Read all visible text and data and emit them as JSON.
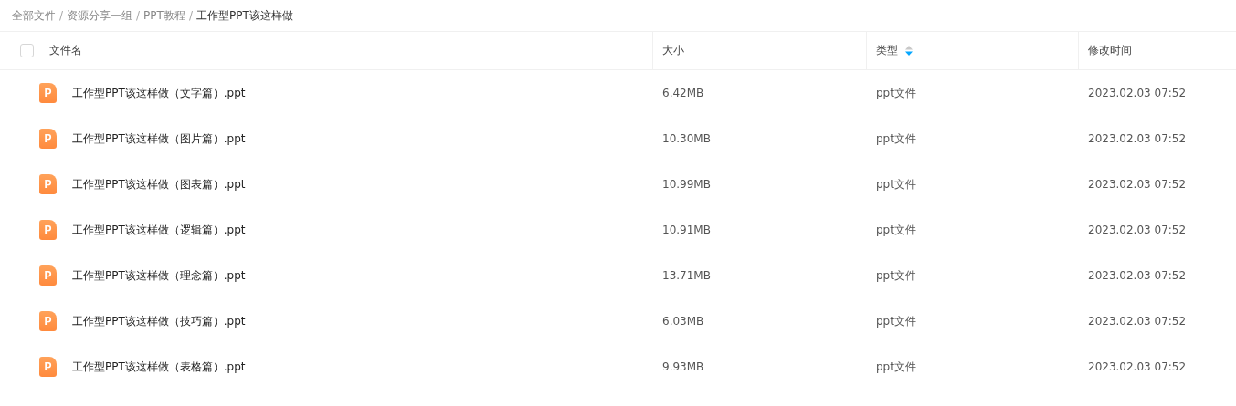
{
  "breadcrumb": [
    {
      "label": "全部文件",
      "current": false
    },
    {
      "label": "资源分享一组",
      "current": false
    },
    {
      "label": "PPT教程",
      "current": false
    },
    {
      "label": "工作型PPT该这样做",
      "current": true
    }
  ],
  "breadcrumb_separator": "/",
  "table": {
    "select_all": {
      "checked": false
    },
    "columns": [
      {
        "label": "文件名",
        "sorted": false
      },
      {
        "label": "大小",
        "sorted": false
      },
      {
        "label": "类型",
        "sorted": true
      },
      {
        "label": "修改时间",
        "sorted": false
      }
    ],
    "rows": [
      {
        "icon_letter": "P",
        "name": "工作型PPT该这样做（文字篇）.ppt",
        "size": "6.42MB",
        "type": "ppt文件",
        "modified": "2023.02.03 07:52"
      },
      {
        "icon_letter": "P",
        "name": "工作型PPT该这样做（图片篇）.ppt",
        "size": "10.30MB",
        "type": "ppt文件",
        "modified": "2023.02.03 07:52"
      },
      {
        "icon_letter": "P",
        "name": "工作型PPT该这样做（图表篇）.ppt",
        "size": "10.99MB",
        "type": "ppt文件",
        "modified": "2023.02.03 07:52"
      },
      {
        "icon_letter": "P",
        "name": "工作型PPT该这样做（逻辑篇）.ppt",
        "size": "10.91MB",
        "type": "ppt文件",
        "modified": "2023.02.03 07:52"
      },
      {
        "icon_letter": "P",
        "name": "工作型PPT该这样做（理念篇）.ppt",
        "size": "13.71MB",
        "type": "ppt文件",
        "modified": "2023.02.03 07:52"
      },
      {
        "icon_letter": "P",
        "name": "工作型PPT该这样做（技巧篇）.ppt",
        "size": "6.03MB",
        "type": "ppt文件",
        "modified": "2023.02.03 07:52"
      },
      {
        "icon_letter": "P",
        "name": "工作型PPT该这样做（表格篇）.ppt",
        "size": "9.93MB",
        "type": "ppt文件",
        "modified": "2023.02.03 07:52"
      }
    ]
  }
}
